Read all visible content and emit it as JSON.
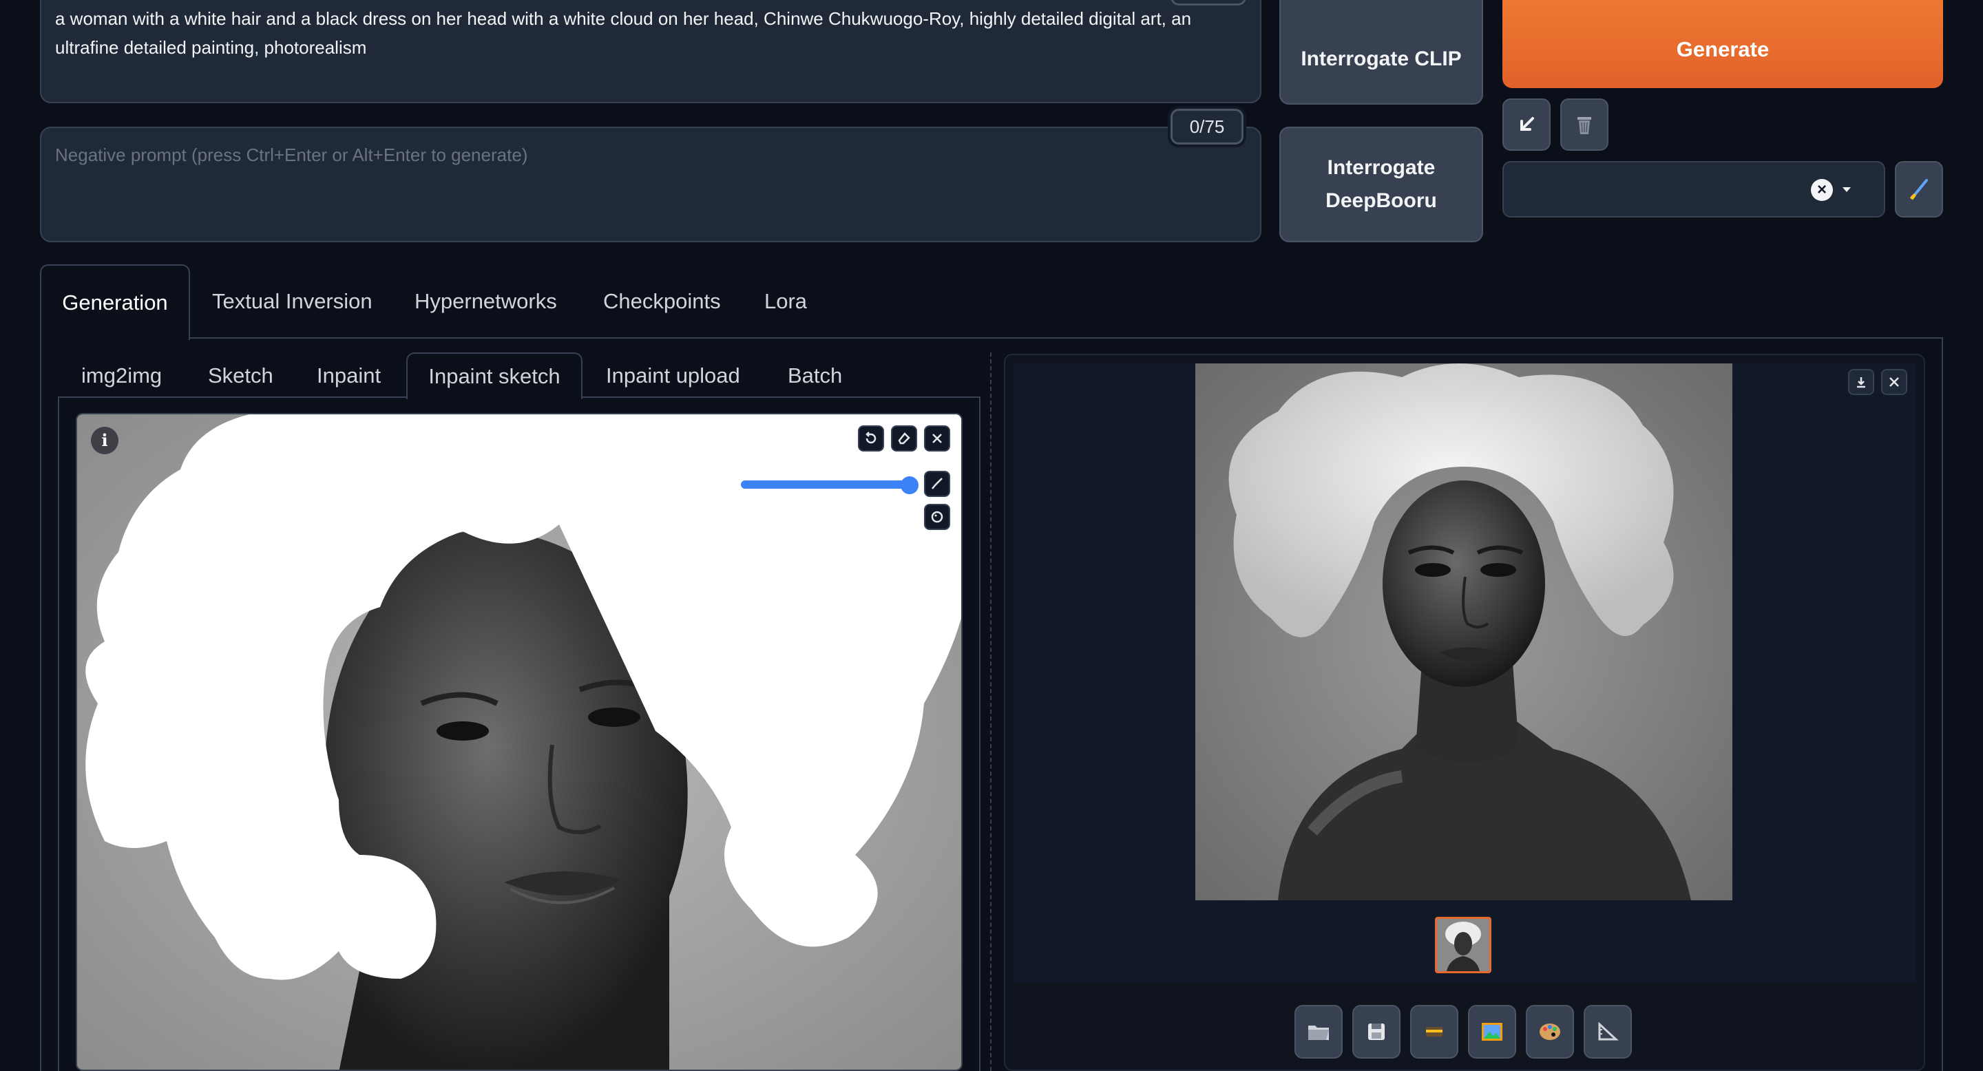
{
  "prompt": {
    "text": "a woman with a white hair and a black dress on her head with a white cloud on her head, Chinwe Chukwuogo-Roy, highly detailed digital art, an ultrafine detailed painting, photorealism"
  },
  "negative_prompt": {
    "placeholder": "Negative prompt (press Ctrl+Enter or Alt+Enter to generate)",
    "counter": "0/75"
  },
  "buttons": {
    "interrogate_clip": "Interrogate CLIP",
    "interrogate_deepbooru_line1": "Interrogate",
    "interrogate_deepbooru_line2": "DeepBooru",
    "generate": "Generate"
  },
  "main_tabs": [
    {
      "label": "Generation"
    },
    {
      "label": "Textual Inversion"
    },
    {
      "label": "Hypernetworks"
    },
    {
      "label": "Checkpoints"
    },
    {
      "label": "Lora"
    }
  ],
  "sub_tabs": [
    {
      "label": "img2img"
    },
    {
      "label": "Sketch"
    },
    {
      "label": "Inpaint"
    },
    {
      "label": "Inpaint sketch"
    },
    {
      "label": "Inpaint upload"
    },
    {
      "label": "Batch"
    }
  ],
  "colors": {
    "accent": "#e8692e",
    "background": "#0b0f19",
    "panel": "#1f2937",
    "brush_slider": "#3b82f6"
  },
  "brush_size_fraction": 0.95,
  "icons": {
    "info": "i",
    "toolbar": [
      "folder-icon",
      "save-icon",
      "zip-icon",
      "image-icon",
      "palette-icon",
      "ruler-icon"
    ]
  }
}
